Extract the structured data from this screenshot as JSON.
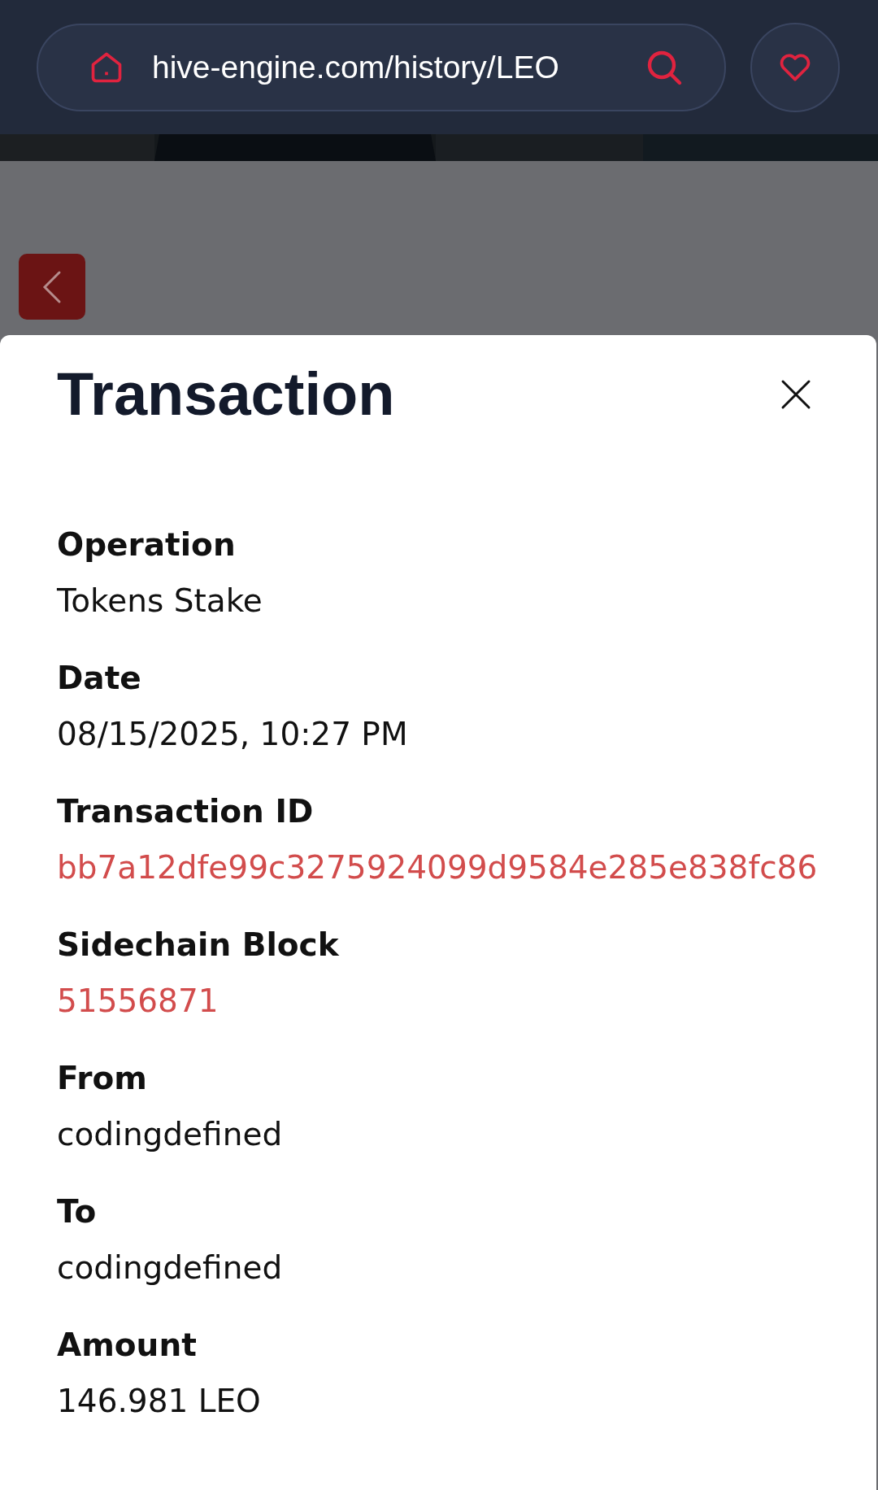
{
  "address_bar": {
    "url": "hive-engine.com/history/LEO"
  },
  "dialog": {
    "title": "Transaction",
    "fields": [
      {
        "label": "Operation",
        "value": "Tokens Stake",
        "kind": "text"
      },
      {
        "label": "Date",
        "value": "08/15/2025, 10:27 PM",
        "kind": "text"
      },
      {
        "label": "Transaction ID",
        "value": "bb7a12dfe99c3275924099d9584e285e838fc86",
        "kind": "link"
      },
      {
        "label": "Sidechain Block",
        "value": "51556871",
        "kind": "link"
      },
      {
        "label": "From",
        "value": "codingdefined",
        "kind": "text"
      },
      {
        "label": "To",
        "value": "codingdefined",
        "kind": "text"
      },
      {
        "label": "Amount",
        "value": "146.981 LEO",
        "kind": "text"
      }
    ]
  }
}
